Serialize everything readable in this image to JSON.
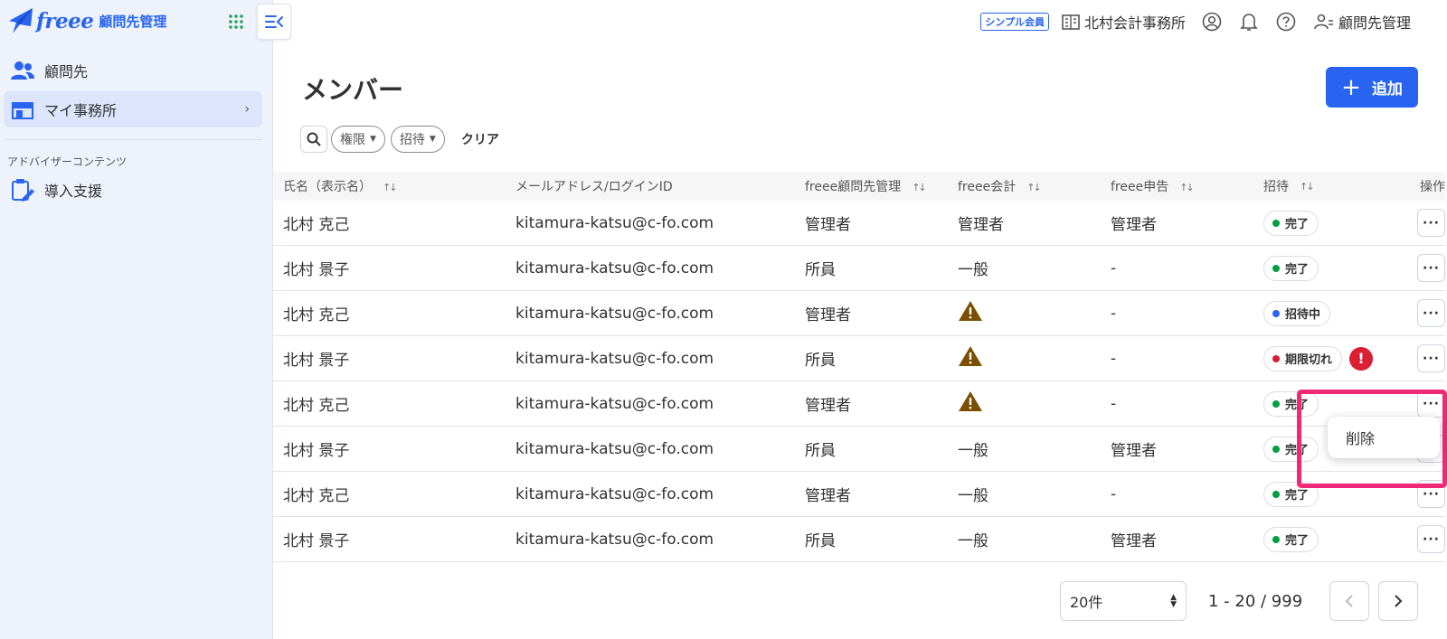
{
  "app": {
    "logo_text": "freee",
    "product_name": "顧問先管理",
    "brand_color": "#2864f0"
  },
  "sidebar": {
    "items": [
      {
        "label": "顧問先",
        "icon": "people-icon",
        "active": false
      },
      {
        "label": "マイ事務所",
        "icon": "office-icon",
        "active": true
      }
    ],
    "section_label": "アドバイザーコンテンツ",
    "section_items": [
      {
        "label": "導入支援",
        "icon": "clipboard-edit-icon"
      }
    ]
  },
  "header": {
    "plan_badge": "シンプル会員",
    "office_name": "北村会計事務所",
    "account_label": "顧問先管理"
  },
  "page": {
    "title": "メンバー",
    "add_button": "追加"
  },
  "filters": {
    "chips": [
      "権限",
      "招待"
    ],
    "clear": "クリア"
  },
  "table": {
    "columns": [
      "氏名（表示名）",
      "メールアドレス/ログインID",
      "freee顧問先管理",
      "freee会計",
      "freee申告",
      "招待",
      "操作"
    ],
    "rows": [
      {
        "name": "北村 克己",
        "email": "kitamura-katsu@c-fo.com",
        "advisor": "管理者",
        "accounting": "管理者",
        "tax": "管理者",
        "status": "完了",
        "status_color": "#00a040",
        "accounting_warn": false,
        "alert": false
      },
      {
        "name": "北村 景子",
        "email": "kitamura-katsu@c-fo.com",
        "advisor": "所員",
        "accounting": "一般",
        "tax": "-",
        "status": "完了",
        "status_color": "#00a040",
        "accounting_warn": false,
        "alert": false
      },
      {
        "name": "北村 克己",
        "email": "kitamura-katsu@c-fo.com",
        "advisor": "管理者",
        "accounting": "",
        "tax": "-",
        "status": "招待中",
        "status_color": "#2864f0",
        "accounting_warn": true,
        "alert": false
      },
      {
        "name": "北村 景子",
        "email": "kitamura-katsu@c-fo.com",
        "advisor": "所員",
        "accounting": "",
        "tax": "-",
        "status": "期限切れ",
        "status_color": "#dc1e32",
        "accounting_warn": true,
        "alert": true
      },
      {
        "name": "北村 克己",
        "email": "kitamura-katsu@c-fo.com",
        "advisor": "管理者",
        "accounting": "",
        "tax": "-",
        "status": "完了",
        "status_color": "#00a040",
        "accounting_warn": true,
        "alert": false
      },
      {
        "name": "北村 景子",
        "email": "kitamura-katsu@c-fo.com",
        "advisor": "所員",
        "accounting": "一般",
        "tax": "管理者",
        "status": "完了",
        "status_color": "#00a040",
        "accounting_warn": false,
        "alert": false
      },
      {
        "name": "北村 克己",
        "email": "kitamura-katsu@c-fo.com",
        "advisor": "管理者",
        "accounting": "一般",
        "tax": "-",
        "status": "完了",
        "status_color": "#00a040",
        "accounting_warn": false,
        "alert": false
      },
      {
        "name": "北村 景子",
        "email": "kitamura-katsu@c-fo.com",
        "advisor": "所員",
        "accounting": "一般",
        "tax": "管理者",
        "status": "完了",
        "status_color": "#00a040",
        "accounting_warn": false,
        "alert": false
      }
    ]
  },
  "context_menu": {
    "items": [
      "削除"
    ]
  },
  "pagination": {
    "per_page": "20件",
    "range": "1 - 20 / 999"
  }
}
